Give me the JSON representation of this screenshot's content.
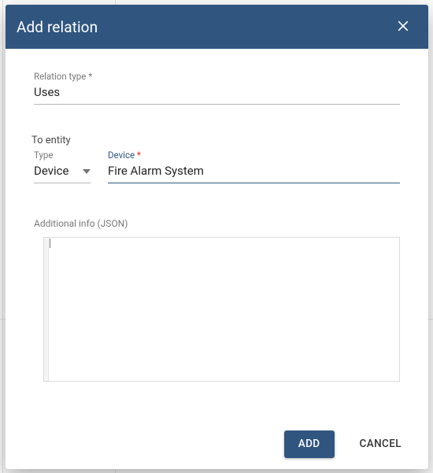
{
  "dialog": {
    "title": "Add relation"
  },
  "relation_type": {
    "label": "Relation type",
    "required_marker": "*",
    "value": "Uses"
  },
  "to_entity": {
    "section_label": "To entity",
    "type": {
      "label": "Type",
      "value": "Device"
    },
    "device": {
      "label": "Device",
      "required_marker": "*",
      "value": "Fire Alarm System"
    }
  },
  "additional_info": {
    "label": "Additional info (JSON)",
    "value": ""
  },
  "actions": {
    "add": "ADD",
    "cancel": "CANCEL"
  }
}
